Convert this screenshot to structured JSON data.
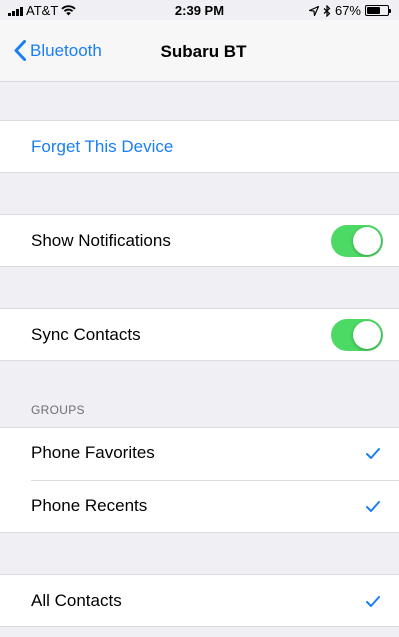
{
  "status_bar": {
    "carrier": "AT&T",
    "time": "2:39 PM",
    "battery_percent": "67%",
    "battery_level": 0.67,
    "icons": [
      "signal-icon",
      "wifi-icon",
      "location-icon",
      "bluetooth-icon",
      "battery-icon"
    ]
  },
  "nav": {
    "back_label": "Bluetooth",
    "title": "Subaru BT"
  },
  "forget": {
    "label": "Forget This Device"
  },
  "notifications": {
    "label": "Show Notifications",
    "enabled": true
  },
  "sync": {
    "label": "Sync Contacts",
    "enabled": true
  },
  "groups": {
    "header": "GROUPS",
    "items": [
      {
        "label": "Phone Favorites",
        "checked": true
      },
      {
        "label": "Phone Recents",
        "checked": true
      }
    ]
  },
  "all_contacts": {
    "label": "All Contacts",
    "checked": true
  },
  "colors": {
    "accent": "#1a7ff2",
    "toggle_on": "#4cd964",
    "background": "#efeff4"
  }
}
